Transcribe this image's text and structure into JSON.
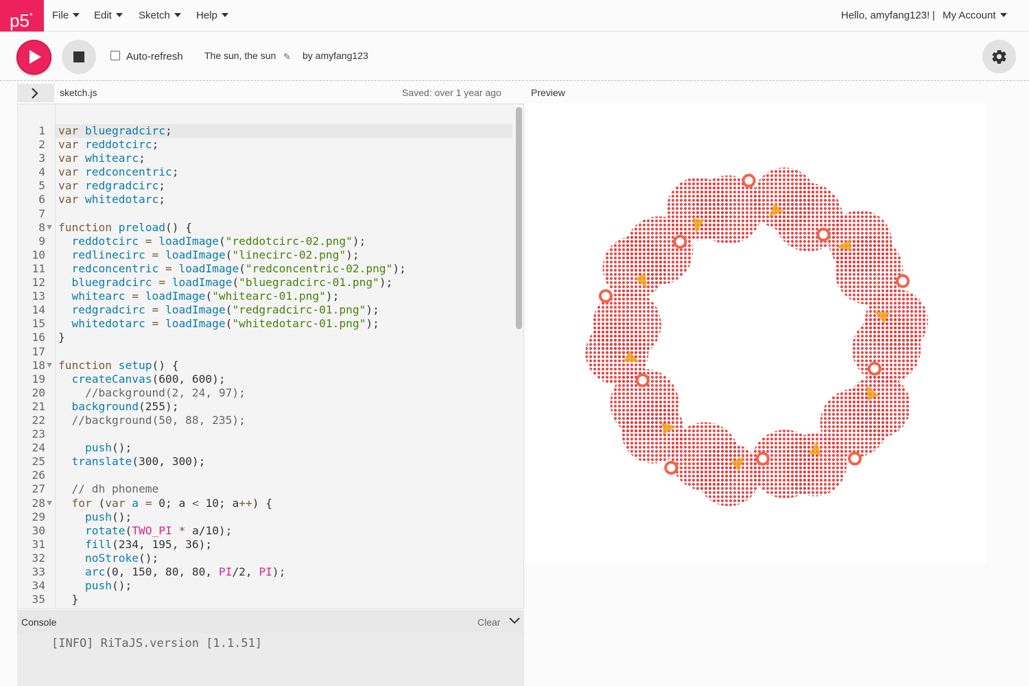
{
  "nav": {
    "logo": "p5",
    "logo_sup": "*",
    "menus": [
      "File",
      "Edit",
      "Sketch",
      "Help"
    ],
    "greeting": "Hello, amyfang123!",
    "separator": "|",
    "account": "My Account"
  },
  "toolbar": {
    "auto_refresh_label": "Auto-refresh",
    "auto_refresh_checked": false,
    "sketch_title": "The sun, the sun",
    "by_line": "by amyfang123"
  },
  "editor": {
    "file_name": "sketch.js",
    "saved_status": "Saved: over 1 year ago",
    "folded_lines": [
      8,
      18,
      28
    ],
    "lines": [
      [
        [
          "kw",
          "var"
        ],
        [
          "t",
          " "
        ],
        [
          "var",
          "bluegradcirc"
        ],
        [
          "t",
          ";"
        ]
      ],
      [
        [
          "kw",
          "var"
        ],
        [
          "t",
          " "
        ],
        [
          "var",
          "reddotcirc"
        ],
        [
          "t",
          ";"
        ]
      ],
      [
        [
          "kw",
          "var"
        ],
        [
          "t",
          " "
        ],
        [
          "var",
          "whitearc"
        ],
        [
          "t",
          ";"
        ]
      ],
      [
        [
          "kw",
          "var"
        ],
        [
          "t",
          " "
        ],
        [
          "var",
          "redconcentric"
        ],
        [
          "t",
          ";"
        ]
      ],
      [
        [
          "kw",
          "var"
        ],
        [
          "t",
          " "
        ],
        [
          "var",
          "redgradcirc"
        ],
        [
          "t",
          ";"
        ]
      ],
      [
        [
          "kw",
          "var"
        ],
        [
          "t",
          " "
        ],
        [
          "var",
          "whitedotarc"
        ],
        [
          "t",
          ";"
        ]
      ],
      [],
      [
        [
          "kw",
          "function"
        ],
        [
          "t",
          " "
        ],
        [
          "fn",
          "preload"
        ],
        [
          "t",
          "() {"
        ]
      ],
      [
        [
          "t",
          "  "
        ],
        [
          "var",
          "reddotcirc"
        ],
        [
          "op",
          " = "
        ],
        [
          "fn",
          "loadImage"
        ],
        [
          "t",
          "("
        ],
        [
          "str",
          "\"reddotcirc-02.png\""
        ],
        [
          "t",
          ");"
        ]
      ],
      [
        [
          "t",
          "  "
        ],
        [
          "var",
          "redlinecirc"
        ],
        [
          "op",
          " = "
        ],
        [
          "fn",
          "loadImage"
        ],
        [
          "t",
          "("
        ],
        [
          "str",
          "\"linecirc-02.png\""
        ],
        [
          "t",
          ");"
        ]
      ],
      [
        [
          "t",
          "  "
        ],
        [
          "var",
          "redconcentric"
        ],
        [
          "op",
          " = "
        ],
        [
          "fn",
          "loadImage"
        ],
        [
          "t",
          "("
        ],
        [
          "str",
          "\"redconcentric-02.png\""
        ],
        [
          "t",
          ");"
        ]
      ],
      [
        [
          "t",
          "  "
        ],
        [
          "var",
          "bluegradcirc"
        ],
        [
          "op",
          " = "
        ],
        [
          "fn",
          "loadImage"
        ],
        [
          "t",
          "("
        ],
        [
          "str",
          "\"bluegradcirc-01.png\""
        ],
        [
          "t",
          ");"
        ]
      ],
      [
        [
          "t",
          "  "
        ],
        [
          "var",
          "whitearc"
        ],
        [
          "op",
          " = "
        ],
        [
          "fn",
          "loadImage"
        ],
        [
          "t",
          "("
        ],
        [
          "str",
          "\"whitearc-01.png\""
        ],
        [
          "t",
          ");"
        ]
      ],
      [
        [
          "t",
          "  "
        ],
        [
          "var",
          "redgradcirc"
        ],
        [
          "op",
          " = "
        ],
        [
          "fn",
          "loadImage"
        ],
        [
          "t",
          "("
        ],
        [
          "str",
          "\"redgradcirc-01.png\""
        ],
        [
          "t",
          ");"
        ]
      ],
      [
        [
          "t",
          "  "
        ],
        [
          "var",
          "whitedotarc"
        ],
        [
          "op",
          " = "
        ],
        [
          "fn",
          "loadImage"
        ],
        [
          "t",
          "("
        ],
        [
          "str",
          "\"whitedotarc-01.png\""
        ],
        [
          "t",
          ");"
        ]
      ],
      [
        [
          "t",
          "}"
        ]
      ],
      [],
      [
        [
          "kw",
          "function"
        ],
        [
          "t",
          " "
        ],
        [
          "fn",
          "setup"
        ],
        [
          "t",
          "() {"
        ]
      ],
      [
        [
          "t",
          "  "
        ],
        [
          "fn",
          "createCanvas"
        ],
        [
          "t",
          "(600, 600);"
        ]
      ],
      [
        [
          "t",
          "    "
        ],
        [
          "com",
          "//background(2, 24, 97);"
        ]
      ],
      [
        [
          "t",
          "  "
        ],
        [
          "fn",
          "background"
        ],
        [
          "t",
          "(255);"
        ]
      ],
      [
        [
          "t",
          "  "
        ],
        [
          "com",
          "//background(50, 88, 235);"
        ]
      ],
      [],
      [
        [
          "t",
          "    "
        ],
        [
          "fn",
          "push"
        ],
        [
          "t",
          "();"
        ]
      ],
      [
        [
          "t",
          "  "
        ],
        [
          "fn",
          "translate"
        ],
        [
          "t",
          "(300, 300);"
        ]
      ],
      [],
      [
        [
          "t",
          "  "
        ],
        [
          "com",
          "// dh phoneme"
        ]
      ],
      [
        [
          "t",
          "  "
        ],
        [
          "kw",
          "for"
        ],
        [
          "t",
          " ("
        ],
        [
          "kw",
          "var"
        ],
        [
          "t",
          " "
        ],
        [
          "var",
          "a"
        ],
        [
          "op",
          " = "
        ],
        [
          "t",
          "0; a "
        ],
        [
          "op",
          "<"
        ],
        [
          "t",
          " 10; a"
        ],
        [
          "op",
          "++"
        ],
        [
          "t",
          ") {"
        ]
      ],
      [
        [
          "t",
          "    "
        ],
        [
          "fn",
          "push"
        ],
        [
          "t",
          "();"
        ]
      ],
      [
        [
          "t",
          "    "
        ],
        [
          "fn",
          "rotate"
        ],
        [
          "t",
          "("
        ],
        [
          "const",
          "TWO_PI"
        ],
        [
          "op",
          " * "
        ],
        [
          "t",
          "a/10);"
        ]
      ],
      [
        [
          "t",
          "    "
        ],
        [
          "fn",
          "fill"
        ],
        [
          "t",
          "(234, 195, 36);"
        ]
      ],
      [
        [
          "t",
          "    "
        ],
        [
          "fn",
          "noStroke"
        ],
        [
          "t",
          "();"
        ]
      ],
      [
        [
          "t",
          "    "
        ],
        [
          "fn",
          "arc"
        ],
        [
          "t",
          "(0, 150, 80, 80, "
        ],
        [
          "const",
          "PI"
        ],
        [
          "t",
          "/2, "
        ],
        [
          "const",
          "PI"
        ],
        [
          "t",
          ");"
        ]
      ],
      [
        [
          "t",
          "    "
        ],
        [
          "fn",
          "push"
        ],
        [
          "t",
          "();"
        ]
      ],
      [
        [
          "t",
          "  }"
        ]
      ]
    ]
  },
  "preview": {
    "label": "Preview",
    "dot_circle_count": 10,
    "arc_wedge_count": 10,
    "marker_ring_count": 10,
    "dot_color": "#e53a3a",
    "arc_color": "#f3a51c",
    "marker_color": "#f0644e"
  },
  "console": {
    "title": "Console",
    "clear_label": "Clear",
    "messages": [
      "[INFO] RiTaJS.version [1.1.51]"
    ]
  },
  "colors": {
    "brand": "#ed225d",
    "button_grey": "#e2e2e2"
  }
}
